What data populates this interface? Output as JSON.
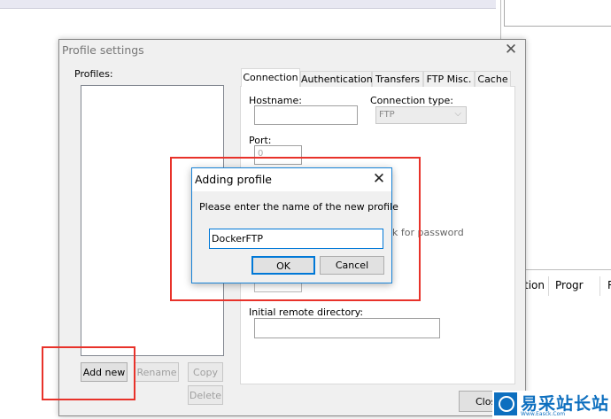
{
  "background": {
    "columns": [
      "tion",
      "Progr",
      "R"
    ]
  },
  "profile_settings": {
    "title": "Profile settings",
    "profiles_label": "Profiles:",
    "buttons": {
      "add_new": "Add new",
      "rename": "Rename",
      "copy": "Copy",
      "delete": "Delete",
      "close": "Close"
    },
    "tabs": [
      "Connection",
      "Authentication",
      "Transfers",
      "FTP Misc.",
      "Cache"
    ],
    "connection": {
      "hostname_label": "Hostname:",
      "connection_type_label": "Connection type:",
      "connection_type_value": "FTP",
      "port_label": "Port:",
      "port_value": "0",
      "password_hint_fragment": "k for password",
      "initial_dir_label": "Initial remote directory:"
    }
  },
  "adding_profile": {
    "title": "Adding profile",
    "prompt": "Please enter the name of the new profile",
    "input_value": "DockerFTP",
    "ok": "OK",
    "cancel": "Cancel"
  },
  "watermark": {
    "text": "易采站长站",
    "subtext": "Www.Easck.Com"
  },
  "colors": {
    "highlight_red": "#e8322a",
    "focus_blue": "#0078d7",
    "watermark_blue": "#0d6fbf"
  }
}
